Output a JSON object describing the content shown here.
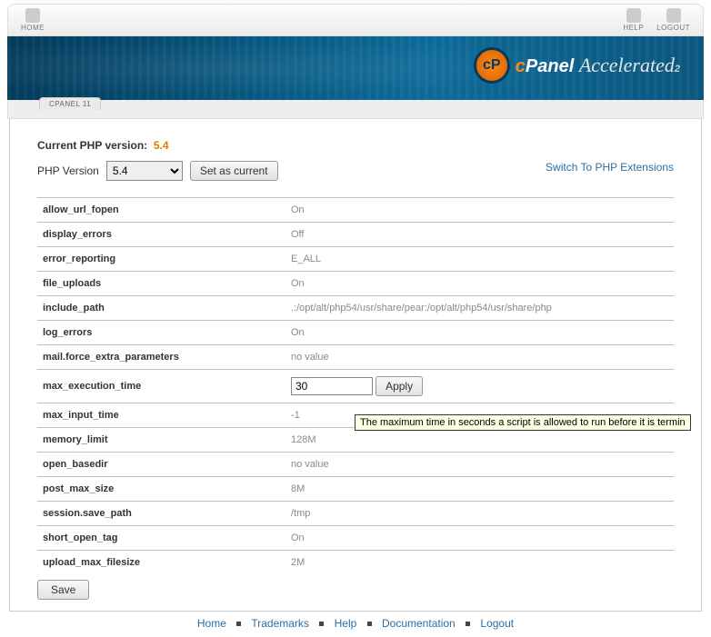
{
  "topbar": {
    "home": "HOME",
    "help": "HELP",
    "logout": "LOGOUT"
  },
  "banner": {
    "brand_c": "c",
    "brand_panel": "Panel",
    "accel": "Accelerated",
    "two": "2",
    "badge": "cP"
  },
  "subbar": {
    "label": "CPANEL 11"
  },
  "current": {
    "label": "Current PHP version:",
    "value": "5.4"
  },
  "version": {
    "label": "PHP Version",
    "selected": "5.4",
    "set_button": "Set as current"
  },
  "switch_link": "Switch To PHP Extensions",
  "settings": [
    {
      "key": "allow_url_fopen",
      "value": "On"
    },
    {
      "key": "display_errors",
      "value": "Off"
    },
    {
      "key": "error_reporting",
      "value": "E_ALL"
    },
    {
      "key": "file_uploads",
      "value": "On"
    },
    {
      "key": "include_path",
      "value": ".:/opt/alt/php54/usr/share/pear:/opt/alt/php54/usr/share/php"
    },
    {
      "key": "log_errors",
      "value": "On"
    },
    {
      "key": "mail.force_extra_parameters",
      "value": "no value"
    },
    {
      "key": "max_execution_time",
      "value": "30",
      "editing": true,
      "apply": "Apply"
    },
    {
      "key": "max_input_time",
      "value": "-1"
    },
    {
      "key": "memory_limit",
      "value": "128M"
    },
    {
      "key": "open_basedir",
      "value": "no value"
    },
    {
      "key": "post_max_size",
      "value": "8M"
    },
    {
      "key": "session.save_path",
      "value": "/tmp"
    },
    {
      "key": "short_open_tag",
      "value": "On"
    },
    {
      "key": "upload_max_filesize",
      "value": "2M"
    }
  ],
  "save_button": "Save",
  "tooltip": "The maximum time in seconds a script is allowed to run before it is termin",
  "footer": {
    "home": "Home",
    "trademarks": "Trademarks",
    "help": "Help",
    "documentation": "Documentation",
    "logout": "Logout"
  }
}
